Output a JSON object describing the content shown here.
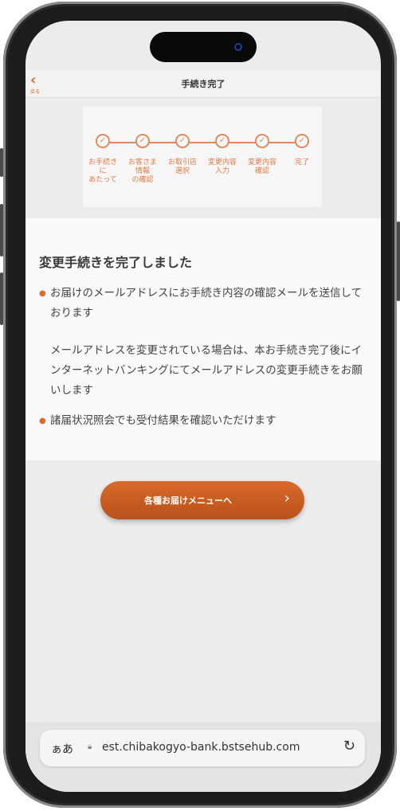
{
  "nav": {
    "back_label": "戻る",
    "title": "手続き完了"
  },
  "steps": [
    {
      "label": "お手続き\nに\nあたって"
    },
    {
      "label": "お客さま\n情報\nの確認"
    },
    {
      "label": "お取引店\n選択"
    },
    {
      "label": "変更内容\n入力"
    },
    {
      "label": "変更内容\n確認"
    },
    {
      "label": "完了"
    }
  ],
  "content": {
    "title": "変更手続きを完了しました",
    "bullet1": "お届けのメールアドレスにお手続き内容の確認メールを送信しております",
    "paragraph": "メールアドレスを変更されている場合は、本お手続き完了後にインターネットバンキングにてメールアドレスの変更手続きをお願いします",
    "bullet2": "諸届状況照会でも受付結果を確認いただけます"
  },
  "cta": {
    "label": "各種お届けメニューへ"
  },
  "browser": {
    "aa": "ぁあ",
    "url": "est.chibakogyo-bank.bstsehub.com"
  },
  "colors": {
    "accent": "#d86a2a",
    "step": "#e08a5a"
  },
  "icons": {
    "back": "chevron-left-icon",
    "step": "check-circle-icon",
    "cta": "chevron-right-icon",
    "lock": "lock-icon",
    "reload": "reload-icon"
  }
}
